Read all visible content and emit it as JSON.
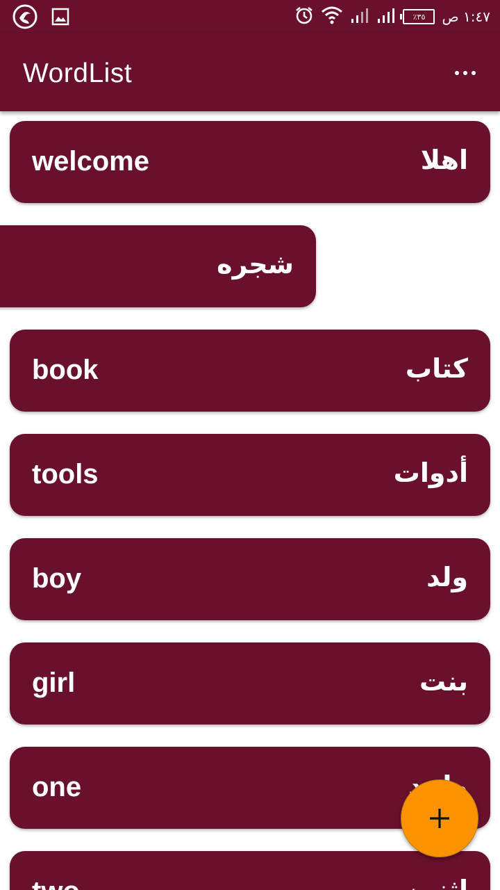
{
  "status_bar": {
    "time": "١:٤٧ ص",
    "battery": "٪٣٥"
  },
  "app_bar": {
    "title": "WordList",
    "overflow_icon": "more-vert-icon"
  },
  "words": [
    {
      "english": "welcome",
      "arabic": "اهلا"
    },
    {
      "english": "",
      "arabic": "شجره"
    },
    {
      "english": "book",
      "arabic": "كتاب"
    },
    {
      "english": "tools",
      "arabic": "أدوات"
    },
    {
      "english": "boy",
      "arabic": "ولد"
    },
    {
      "english": "girl",
      "arabic": "بنت"
    },
    {
      "english": "one",
      "arabic": "واحد"
    },
    {
      "english": "two",
      "arabic": "اثنين"
    }
  ],
  "fab": {
    "icon": "add-icon"
  },
  "colors": {
    "primary": "#69102c",
    "accent": "#fb9300",
    "text_on_primary": "#ffffff"
  }
}
